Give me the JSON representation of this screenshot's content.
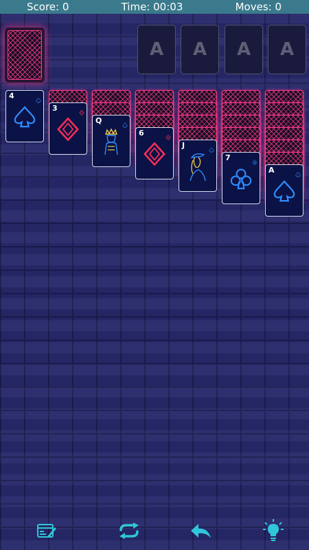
{
  "status": {
    "score_label": "Score: 0",
    "time_label": "Time: 00:03",
    "moves_label": "Moves: 0"
  },
  "foundations": [
    "A",
    "A",
    "A",
    "A"
  ],
  "tableau": [
    {
      "facedown": 0,
      "faceup": {
        "rank": "4",
        "suit": "spade",
        "color": "blue"
      }
    },
    {
      "facedown": 1,
      "faceup": {
        "rank": "3",
        "suit": "diamond",
        "color": "red"
      }
    },
    {
      "facedown": 2,
      "faceup": {
        "rank": "Q",
        "suit": "spade",
        "color": "blue"
      }
    },
    {
      "facedown": 3,
      "faceup": {
        "rank": "6",
        "suit": "diamond",
        "color": "red"
      }
    },
    {
      "facedown": 4,
      "faceup": {
        "rank": "J",
        "suit": "spade",
        "color": "blue"
      }
    },
    {
      "facedown": 5,
      "faceup": {
        "rank": "7",
        "suit": "club",
        "color": "blue"
      }
    },
    {
      "facedown": 6,
      "faceup": {
        "rank": "A",
        "suit": "spade",
        "color": "blue"
      }
    }
  ],
  "toolbar": {
    "icons": [
      "new-game-icon",
      "restart-icon",
      "undo-icon",
      "hint-icon"
    ],
    "color": "#2fc7d9"
  },
  "colors": {
    "neon_pink": "#ff3c8a",
    "neon_blue": "#2f8cff",
    "neon_red": "#ff2e5a",
    "status_bar": "#3a7a8c"
  }
}
